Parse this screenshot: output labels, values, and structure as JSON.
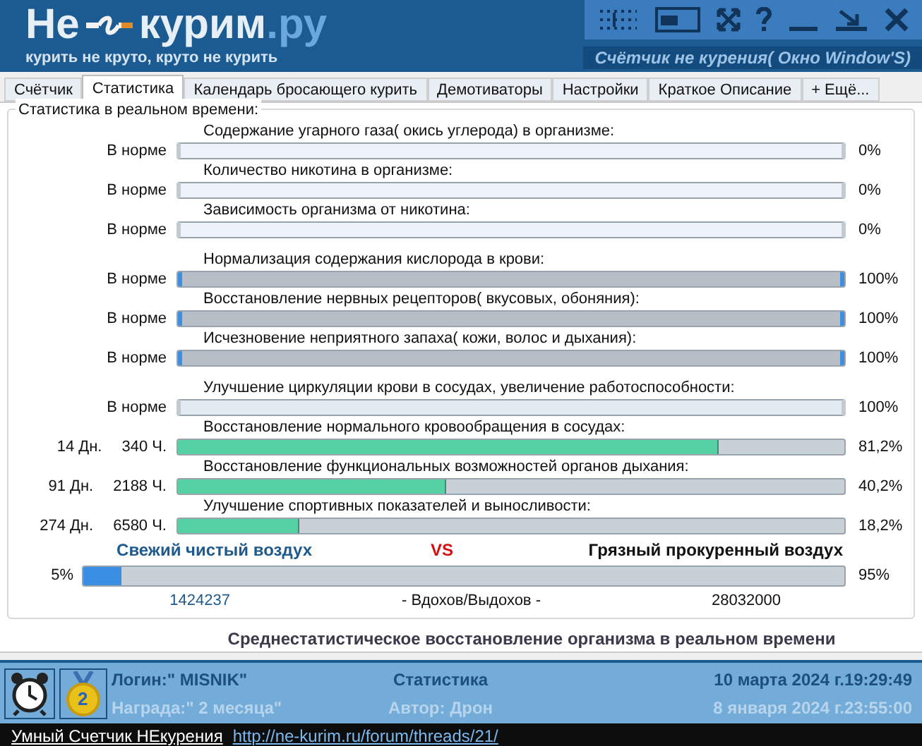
{
  "header": {
    "logo": {
      "part_1": "Не",
      "part_2": "курим",
      "part_3": ".ру"
    },
    "slogan": "курить не круто, круто не курить",
    "subtitle": "Счётчик не курения( Окно Window'S)"
  },
  "tabs": [
    {
      "label": "Счётчик",
      "selected": false
    },
    {
      "label": "Статистика",
      "selected": true
    },
    {
      "label": "Календарь бросающего курить",
      "selected": false
    },
    {
      "label": "Демотиваторы",
      "selected": false
    },
    {
      "label": "Настройки",
      "selected": false
    },
    {
      "label": "Краткое Описание",
      "selected": false
    },
    {
      "label": "+ Ещё...",
      "selected": false
    }
  ],
  "panel": {
    "title": "Статистика в реальном времени:",
    "groups": [
      {
        "rows": [
          {
            "label": "Содержание угарного газа( окись углерода) в организме:",
            "status": "В норме",
            "kind": "light",
            "level": 0,
            "percent": "0%"
          },
          {
            "label": "Количество никотина в организме:",
            "status": "В норме",
            "kind": "light",
            "level": 0,
            "percent": "0%"
          },
          {
            "label": "Зависимость организма от никотина:",
            "status": "В норме",
            "kind": "light",
            "level": 0,
            "percent": "0%"
          }
        ]
      },
      {
        "rows": [
          {
            "label": "Нормализация содержания кислорода в крови:",
            "status": "В норме",
            "kind": "gray",
            "level": 1,
            "percent": "100%"
          },
          {
            "label": "Восстановление нервных рецепторов( вкусовых, обоняния):",
            "status": "В норме",
            "kind": "gray",
            "level": 1,
            "percent": "100%"
          },
          {
            "label": "Исчезновение неприятного запаха( кожи, волос и дыхания):",
            "status": "В норме",
            "kind": "gray",
            "level": 1,
            "percent": "100%"
          }
        ]
      },
      {
        "rows": [
          {
            "label": "Улучшение циркуляции крови в сосудах, увеличение работоспособности:",
            "status": "В норме",
            "kind": "light",
            "level": 1,
            "percent": "100%"
          },
          {
            "label": "Восстановление нормального кровообращения в сосудах:",
            "days": "14 Дн.",
            "hours": "340 Ч.",
            "kind": "green",
            "level": 0.812,
            "percent": "81,2%"
          },
          {
            "label": "Восстановление функциональных возможностей органов дыхания:",
            "days": "91 Дн.",
            "hours": "2188 Ч.",
            "kind": "green",
            "level": 0.402,
            "percent": "40,2%"
          },
          {
            "label": "Улучшение спортивных показателей и выносливости:",
            "days": "274 Дн.",
            "hours": "6580 Ч.",
            "kind": "green",
            "level": 0.182,
            "percent": "18,2%"
          }
        ]
      }
    ],
    "air": {
      "fresh_label": "Свежий чистый воздух",
      "vs": "VS",
      "dirty_label": "Грязный прокуренный воздух",
      "fresh_percent": "5%",
      "level": 0.05,
      "dirty_percent": "95%",
      "fresh_count": "1424237",
      "caption": "- Вдохов/Выдохов -",
      "dirty_count": "28032000"
    }
  },
  "summary": "Среднестатистическое восстановление организма в реальном времени",
  "status_panel": {
    "medal_number": "2",
    "login": "Логин:\" MISNIK\"",
    "award": "Награда:\" 2 месяца\"",
    "section": "Статистика",
    "author": "Автор: Дрон",
    "now": "10 марта 2024 г.19:29:49",
    "start": "8 января 2024 г.23:55:00"
  },
  "footer": {
    "app_link": "Умный Счетчик НЕкурения",
    "url": "http://ne-kurim.ru/forum/threads/21/"
  }
}
